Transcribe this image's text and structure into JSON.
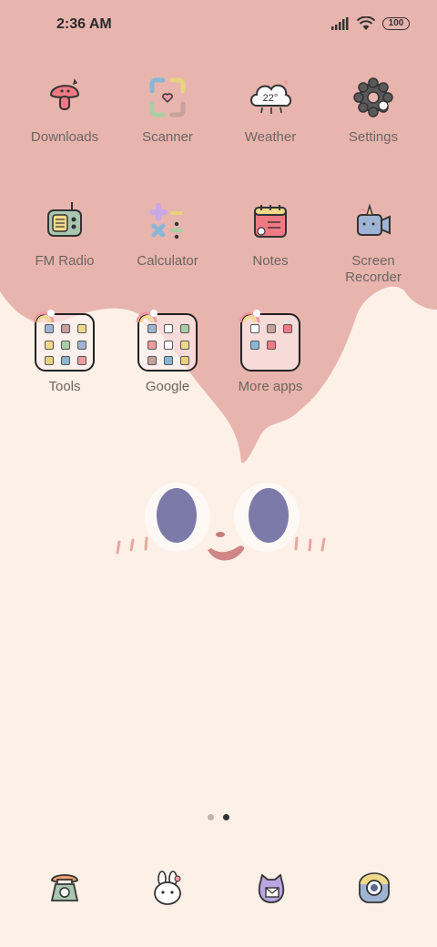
{
  "status": {
    "time": "2:36 AM",
    "battery": "100"
  },
  "apps": [
    {
      "label": "Downloads",
      "icon": "mushroom-download-icon"
    },
    {
      "label": "Scanner",
      "icon": "scanner-icon"
    },
    {
      "label": "Weather",
      "icon": "cloud-weather-icon",
      "temp": "22°"
    },
    {
      "label": "Settings",
      "icon": "gear-icon"
    },
    {
      "label": "FM Radio",
      "icon": "radio-icon"
    },
    {
      "label": "Calculator",
      "icon": "calculator-icon"
    },
    {
      "label": "Notes",
      "icon": "notepad-icon"
    },
    {
      "label": "Screen Recorder",
      "label_line1": "Screen",
      "label_line2": "Recorder",
      "icon": "camcorder-icon"
    }
  ],
  "folders": [
    {
      "label": "Tools"
    },
    {
      "label": "Google"
    },
    {
      "label": "More apps"
    }
  ],
  "page_indicator": {
    "pages": 2,
    "current": 2
  },
  "dock": [
    {
      "icon": "phone-icon"
    },
    {
      "icon": "bunny-contacts-icon"
    },
    {
      "icon": "cat-messages-icon"
    },
    {
      "icon": "camera-icon"
    }
  ],
  "colors": {
    "pink": "#e8b4ae",
    "cream": "#fdf0e7",
    "eye": "#7b7aa8",
    "label": "#6d6560"
  }
}
